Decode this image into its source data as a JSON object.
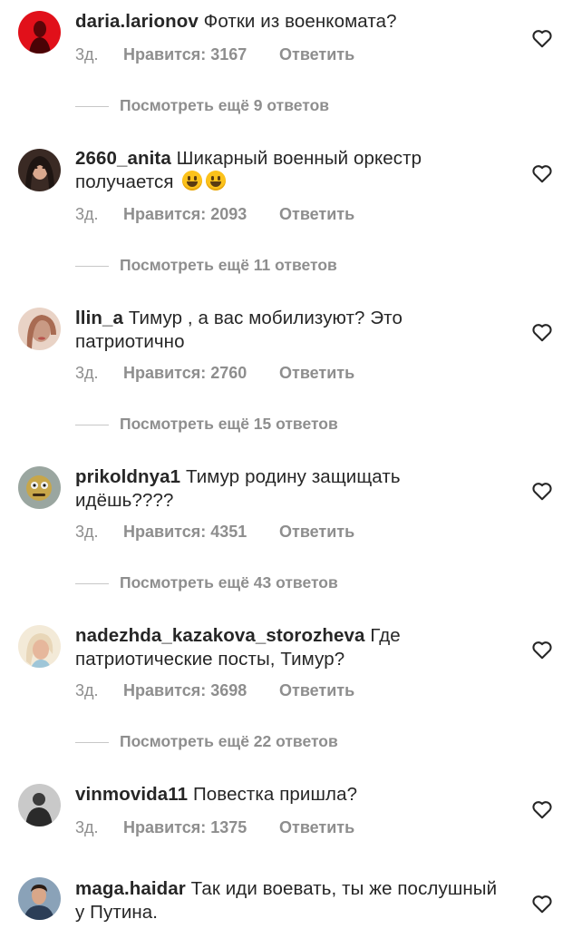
{
  "labels": {
    "likes_prefix": "Нравится: ",
    "reply": "Ответить",
    "view_replies_prefix": "Посмотреть ещё ",
    "view_replies_suffix": " ответов"
  },
  "comments": [
    {
      "username": "daria.larionov",
      "text": "Фотки из военкомата?",
      "age": "3д.",
      "likes": "Нравится: 3167",
      "reply": "Ответить",
      "view_replies": "Посмотреть ещё 9 ответов",
      "avatar_color": "#e1101a"
    },
    {
      "username": "2660_anita",
      "text": "Шикарный военный оркестр получается",
      "emoji": [
        "grinning-face",
        "grinning-face"
      ],
      "age": "3д.",
      "likes": "Нравится: 2093",
      "reply": "Ответить",
      "view_replies": "Посмотреть ещё 11 ответов",
      "avatar_color": "#3a2a24"
    },
    {
      "username": "llin_a",
      "text": "Тимур , а вас мобилизуют? Это патриотично",
      "age": "3д.",
      "likes": "Нравится: 2760",
      "reply": "Ответить",
      "view_replies": "Посмотреть ещё 15 ответов",
      "avatar_color": "#c99a84"
    },
    {
      "username": "prikoldnya1",
      "text": "Тимур родину защищать идёшь????",
      "age": "3д.",
      "likes": "Нравится: 4351",
      "reply": "Ответить",
      "view_replies": "Посмотреть ещё 43 ответов",
      "avatar_color": "#9aa6a0"
    },
    {
      "username": "nadezhda_kazakova_storozheva",
      "text": "Где патриотические посты, Тимур?",
      "age": "3д.",
      "likes": "Нравится: 3698",
      "reply": "Ответить",
      "view_replies": "Посмотреть ещё 22 ответов",
      "avatar_color": "#e8d6b8"
    },
    {
      "username": "vinmovida11",
      "text": "Повестка пришла?",
      "age": "3д.",
      "likes": "Нравится: 1375",
      "reply": "Ответить",
      "avatar_color": "#3b3b3b"
    },
    {
      "username": "maga.haidar",
      "text": "Так иди воевать, ты же послушный у Путина.",
      "avatar_color": "#8aa2b8"
    }
  ],
  "colors": {
    "text": "#262626",
    "secondary": "#8e8e8e",
    "rule": "#c7c7c7"
  }
}
